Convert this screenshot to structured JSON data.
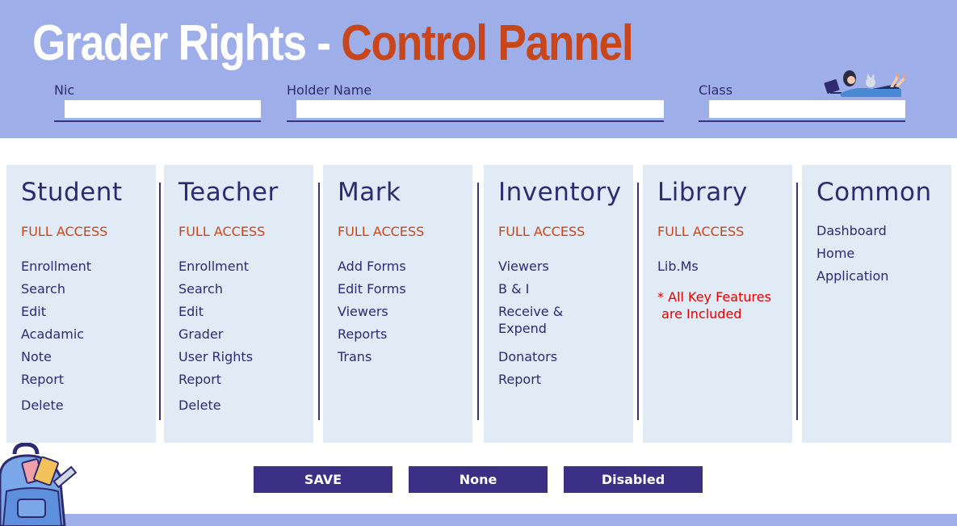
{
  "header": {
    "title_white": "Grader Rights - ",
    "title_orange": "Control Pannel",
    "fields": {
      "nic": {
        "label": "Nic",
        "value": ""
      },
      "holder": {
        "label": "Holder Name",
        "value": ""
      },
      "class": {
        "label": "Class",
        "value": ""
      }
    }
  },
  "columns": [
    {
      "title": "Student",
      "access": "FULL ACCESS",
      "items": [
        "Enrollment",
        "Search",
        "Edit",
        "Acadamic",
        "Note",
        "Report",
        "Delete"
      ]
    },
    {
      "title": "Teacher",
      "access": "FULL ACCESS",
      "items": [
        "Enrollment",
        "Search",
        "Edit",
        "Grader",
        "User Rights",
        "Report",
        "Delete"
      ]
    },
    {
      "title": "Mark",
      "access": "FULL ACCESS",
      "items": [
        "Add Forms",
        "Edit Forms",
        "Viewers",
        "Reports",
        "Trans"
      ]
    },
    {
      "title": "Inventory",
      "access": "FULL ACCESS",
      "items": [
        "Viewers",
        "B & I",
        "Receive &",
        "Expend",
        "Donators",
        "Report"
      ]
    },
    {
      "title": "Library",
      "access": "FULL ACCESS",
      "items": [
        "Lib.Ms"
      ],
      "note_line1": "* All Key Features",
      "note_line2": " are Included"
    },
    {
      "title": "Common",
      "items": [
        "Dashboard",
        "Home",
        "Application"
      ]
    }
  ],
  "buttons": {
    "save": "SAVE",
    "none": "None",
    "disabled": "Disabled"
  },
  "colors": {
    "header_bg": "#9daee8",
    "title_accent": "#c9461b",
    "panel_bg": "#e0ebf5",
    "text": "#2e2a70",
    "button_bg": "#3b2f86",
    "note_red": "#e00000"
  }
}
